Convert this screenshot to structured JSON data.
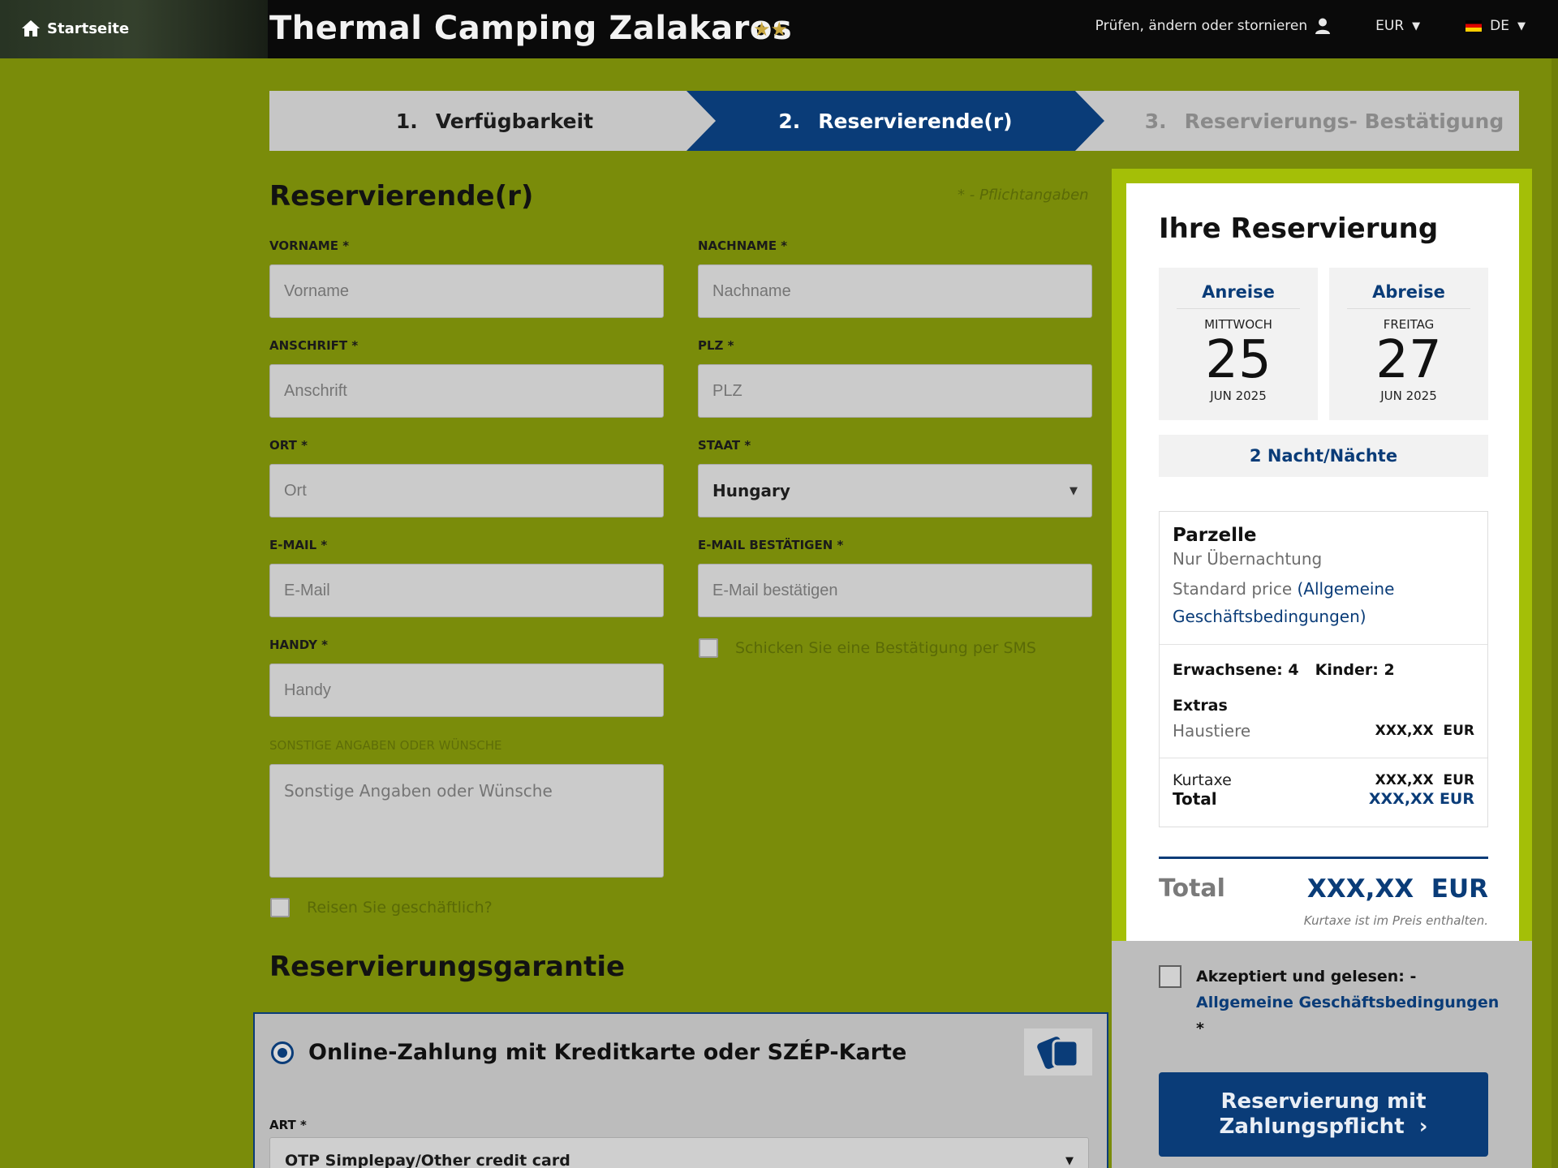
{
  "header": {
    "home_label": "Startseite",
    "title": "Thermal Camping Zalakaros",
    "stars": "★★",
    "manage_label": "Prüfen, ändern oder stornieren",
    "currency": "EUR",
    "language": "DE"
  },
  "steps": [
    {
      "num": "1.",
      "label": "Verfügbarkeit"
    },
    {
      "num": "2.",
      "label": "Reservierende(r)"
    },
    {
      "num": "3.",
      "label": "Reservierungs- Bestätigung"
    }
  ],
  "form": {
    "title": "Reservierende(r)",
    "required_note": "* - Pflichtangaben",
    "firstname": {
      "label": "VORNAME *",
      "placeholder": "Vorname"
    },
    "lastname": {
      "label": "NACHNAME *",
      "placeholder": "Nachname"
    },
    "address": {
      "label": "ANSCHRIFT *",
      "placeholder": "Anschrift"
    },
    "zip": {
      "label": "PLZ *",
      "placeholder": "PLZ"
    },
    "city": {
      "label": "ORT *",
      "placeholder": "Ort"
    },
    "country": {
      "label": "STAAT *",
      "value": "Hungary"
    },
    "email": {
      "label": "E-MAIL *",
      "placeholder": "E-Mail"
    },
    "email_confirm": {
      "label": "E-MAIL BESTÄTIGEN *",
      "placeholder": "E-Mail bestätigen"
    },
    "sms_label": "Schicken Sie eine Bestätigung per SMS",
    "mobile": {
      "label": "HANDY *",
      "placeholder": "Handy"
    },
    "notes": {
      "label": "SONSTIGE ANGABEN ODER WÜNSCHE",
      "placeholder": "Sonstige Angaben oder Wünsche"
    },
    "business_label": "Reisen Sie geschäftlich?"
  },
  "guarantee": {
    "title": "Reservierungsgarantie",
    "option": "Online-Zahlung mit Kreditkarte oder SZÉP-Karte",
    "type_label": "ART *",
    "type_value": "OTP Simplepay/Other credit card"
  },
  "summary": {
    "title": "Ihre Reservierung",
    "arrival": {
      "label": "Anreise",
      "dow": "MITTWOCH",
      "day": "25",
      "monthyear": "JUN 2025"
    },
    "departure": {
      "label": "Abreise",
      "dow": "FREITAG",
      "day": "27",
      "monthyear": "JUN 2025"
    },
    "nights": "2 Nacht/Nächte",
    "unit_title": "Parzelle",
    "unit_type": "Nur Übernachtung",
    "price_prefix": "Standard price ",
    "price_link_line1": "(Allgemeine",
    "price_link_line2": "Geschäftsbedingungen)",
    "adults": "Erwachsene: 4",
    "children": "Kinder: 2",
    "extras_title": "Extras",
    "extra_item": "Haustiere",
    "extra_price": "XXX,XX",
    "extra_currency": "EUR",
    "tax_label": "Kurtaxe",
    "tax_price": "XXX,XX",
    "tax_currency": "EUR",
    "subtotal_label": "Total",
    "subtotal_value": "XXX,XX EUR",
    "total_label": "Total",
    "total_value": "XXX,XX",
    "total_currency": "EUR",
    "tax_note": "Kurtaxe ist im Preis enthalten."
  },
  "agreement": {
    "prefix": "Akzeptiert und gelesen: -",
    "link": "Allgemeine Geschäftsbedingungen",
    "asterisk": "*"
  },
  "cta": {
    "line1": "Reservierung mit",
    "line2": "Zahlungspflicht",
    "arrow": "›"
  },
  "colors": {
    "brand_blue": "#0a3c78",
    "page_green": "#7a8c0a",
    "summary_border": "#a4bf07"
  }
}
